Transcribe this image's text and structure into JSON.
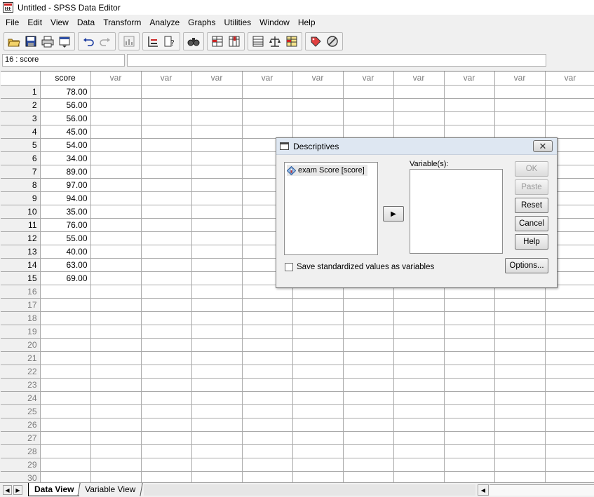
{
  "window": {
    "title": "Untitled - SPSS Data Editor"
  },
  "menu": [
    "File",
    "Edit",
    "View",
    "Data",
    "Transform",
    "Analyze",
    "Graphs",
    "Utilities",
    "Window",
    "Help"
  ],
  "toolbar": {
    "groups": [
      [
        {
          "icon": "open-icon"
        },
        {
          "icon": "save-icon"
        },
        {
          "icon": "print-icon"
        },
        {
          "icon": "dialog-recall-icon"
        }
      ],
      [
        {
          "icon": "undo-icon"
        },
        {
          "icon": "redo-icon"
        }
      ],
      [
        {
          "icon": "chart-icon"
        }
      ],
      [
        {
          "icon": "goto-case-icon"
        },
        {
          "icon": "variables-icon"
        }
      ],
      [
        {
          "icon": "find-icon"
        }
      ],
      [
        {
          "icon": "insert-case-icon"
        },
        {
          "icon": "insert-variable-icon"
        }
      ],
      [
        {
          "icon": "split-file-icon"
        },
        {
          "icon": "weight-cases-icon"
        },
        {
          "icon": "select-cases-icon"
        }
      ],
      [
        {
          "icon": "value-labels-icon"
        },
        {
          "icon": "use-sets-icon"
        }
      ]
    ]
  },
  "cell_reference": "16 : score",
  "cell_value": "",
  "grid": {
    "columns": [
      "score",
      "var",
      "var",
      "var",
      "var",
      "var",
      "var",
      "var",
      "var",
      "var",
      "var"
    ],
    "rows": [
      "1",
      "2",
      "3",
      "4",
      "5",
      "6",
      "7",
      "8",
      "9",
      "10",
      "11",
      "12",
      "13",
      "14",
      "15",
      "16",
      "17",
      "18",
      "19",
      "20",
      "21",
      "22",
      "23",
      "24",
      "25",
      "26",
      "27",
      "28",
      "29",
      "30"
    ],
    "filled_rows": 15,
    "score": [
      "78.00",
      "56.00",
      "56.00",
      "45.00",
      "54.00",
      "34.00",
      "89.00",
      "97.00",
      "94.00",
      "35.00",
      "76.00",
      "55.00",
      "40.00",
      "63.00",
      "69.00"
    ]
  },
  "tabs": {
    "data_view": "Data View",
    "variable_view": "Variable View"
  },
  "dialog": {
    "title": "Descriptives",
    "close": "✕",
    "source_variables": [
      "exam Score [score]"
    ],
    "variables_label": "Variable(s):",
    "move_arrow": "▶",
    "buttons": {
      "ok": "OK",
      "paste": "Paste",
      "reset": "Reset",
      "cancel": "Cancel",
      "help": "Help"
    },
    "save_checkbox_label": "Save standardized values as variables",
    "save_checked": false,
    "options": "Options..."
  }
}
